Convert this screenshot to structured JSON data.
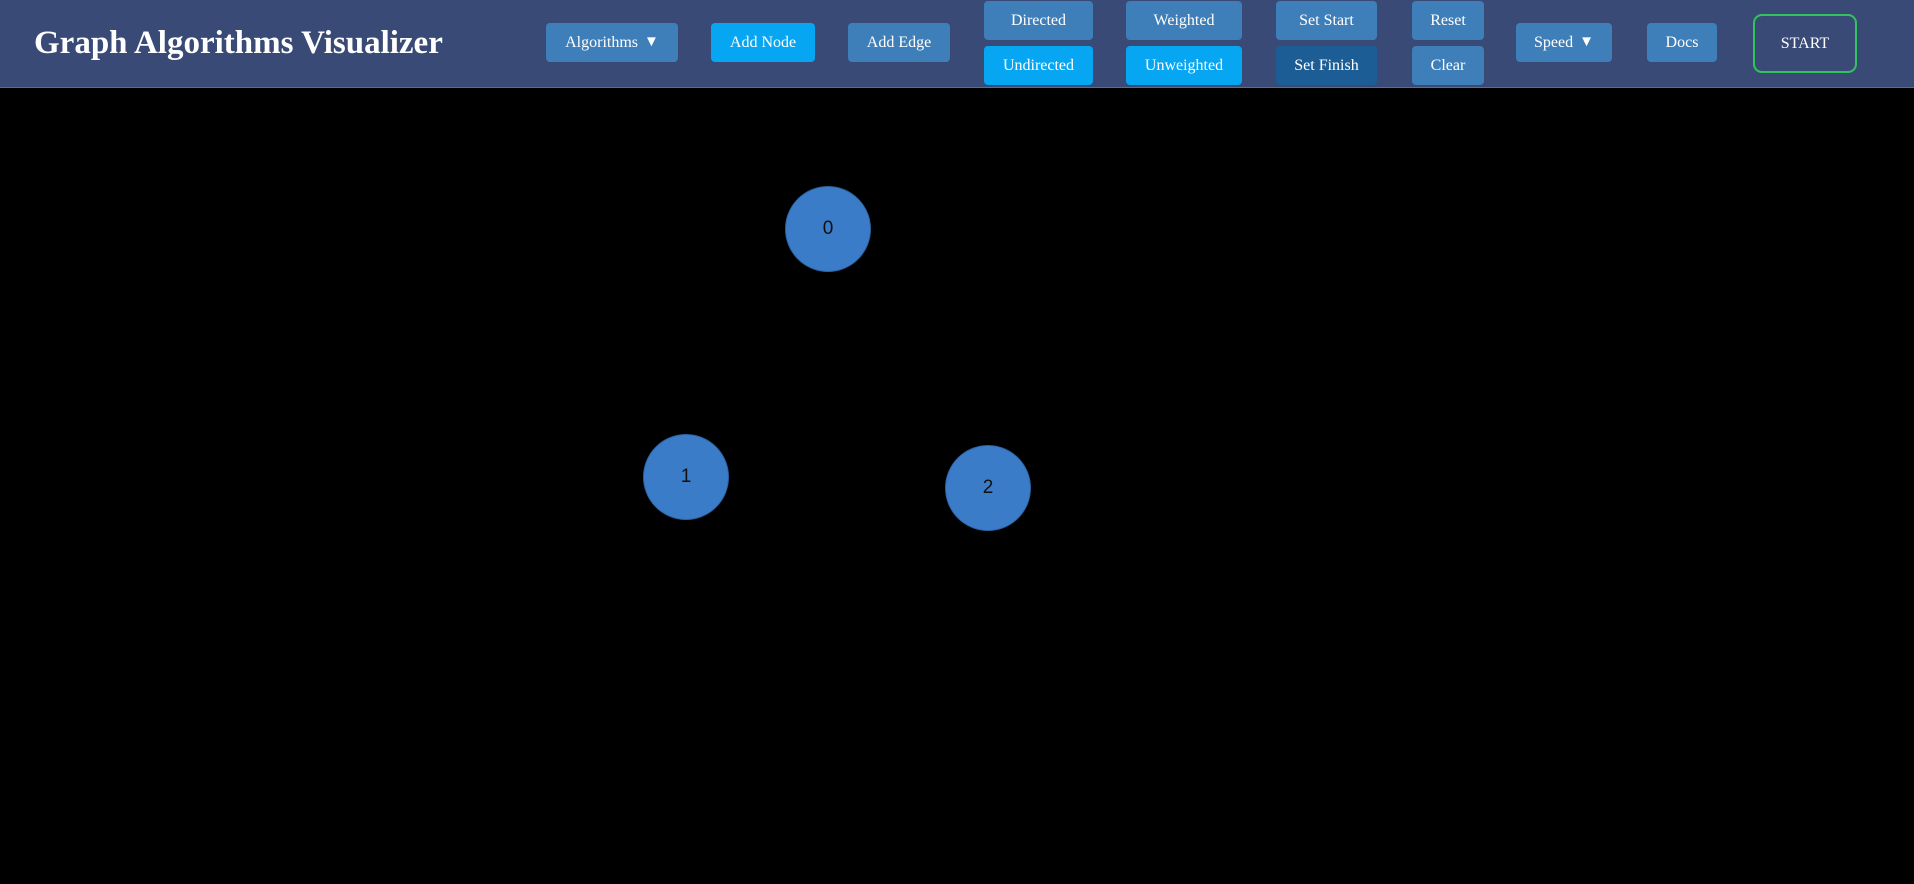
{
  "header": {
    "title": "Graph Algorithms Visualizer"
  },
  "toolbar": {
    "algorithms_label": "Algorithms",
    "add_node_label": "Add Node",
    "add_edge_label": "Add Edge",
    "directed_label": "Directed",
    "undirected_label": "Undirected",
    "weighted_label": "Weighted",
    "unweighted_label": "Unweighted",
    "set_start_label": "Set Start",
    "set_finish_label": "Set Finish",
    "reset_label": "Reset",
    "clear_label": "Clear",
    "speed_label": "Speed",
    "docs_label": "Docs",
    "start_label": "START",
    "dropdown_icon_glyph": "▼"
  },
  "state": {
    "mode": "Add Node",
    "directed": false,
    "weighted": false,
    "selected_action": "Set Finish"
  },
  "graph": {
    "nodes": [
      {
        "label": "0"
      },
      {
        "label": "1"
      },
      {
        "label": "2"
      }
    ],
    "edges": []
  },
  "colors": {
    "navbar": "#384a75",
    "button": "#3f7fb9",
    "button_active": "#07a6f2",
    "button_selected": "#1d5d96",
    "start_border": "#32c45c",
    "node_fill": "#3b7cc8",
    "canvas": "#000000"
  }
}
